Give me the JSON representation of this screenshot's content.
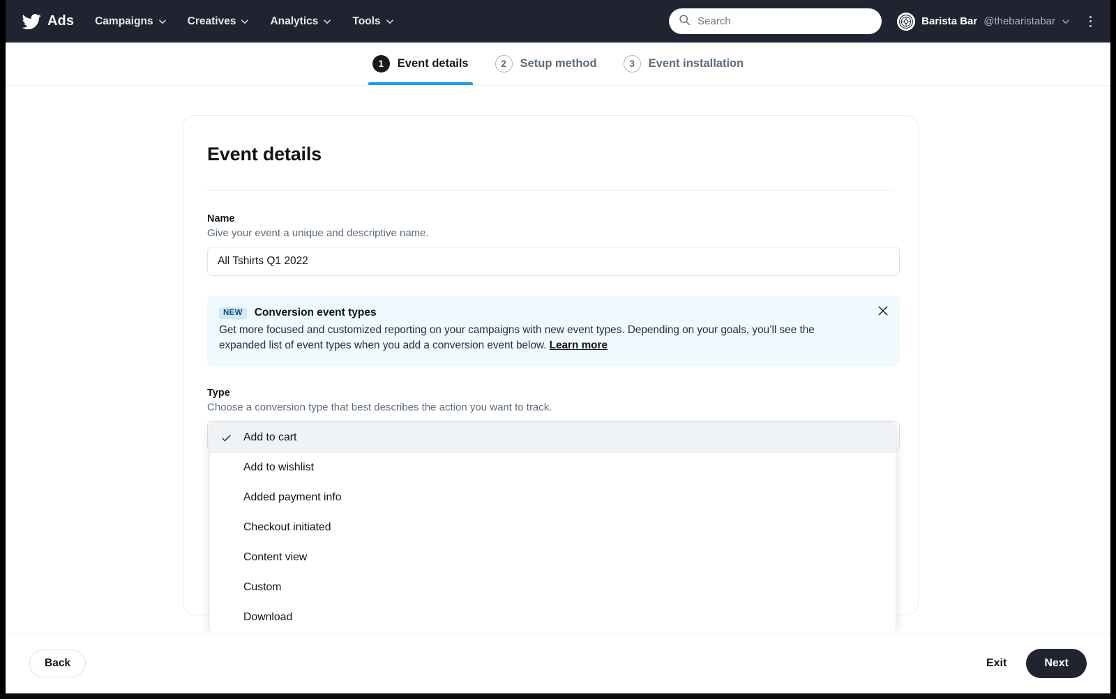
{
  "header": {
    "brand": "Ads",
    "brand_icon": "twitter-bird-icon",
    "nav_items": [
      {
        "label": "Campaigns",
        "icon": "chevron-down-icon"
      },
      {
        "label": "Creatives",
        "icon": "chevron-down-icon"
      },
      {
        "label": "Analytics",
        "icon": "chevron-down-icon"
      },
      {
        "label": "Tools",
        "icon": "chevron-down-icon"
      }
    ],
    "search": {
      "placeholder": "Search",
      "value": "",
      "icon": "search-icon"
    },
    "account": {
      "avatar_icon": "account-avatar-icon",
      "name": "Barista Bar",
      "handle": "@thebaristabar",
      "caret_icon": "chevron-down-icon"
    },
    "overflow_icon": "kebab-menu-icon"
  },
  "steps": [
    {
      "num": "1",
      "label": "Event details",
      "state": "active"
    },
    {
      "num": "2",
      "label": "Setup method",
      "state": "idle"
    },
    {
      "num": "3",
      "label": "Event installation",
      "state": "idle"
    }
  ],
  "card": {
    "title": "Event details",
    "name_field": {
      "label": "Name",
      "help": "Give your event a unique and descriptive name.",
      "value": "All Tshirts Q1 2022",
      "placeholder": ""
    },
    "banner": {
      "badge": "NEW",
      "title": "Conversion event types",
      "body": "Get more focused and customized reporting on your campaigns with new event types. Depending on your goals, you’ll see the expanded list of event types when you add a conversion event below.",
      "link": "Learn more",
      "close_icon": "close-icon",
      "bg_color": "#f0f9fd",
      "badge_bg": "#cfe9fa"
    },
    "type_field": {
      "label": "Type",
      "help": "Choose a conversion type that best describes the action you want to track.",
      "selected": "Add to cart",
      "caret_icon": "chevron-down-icon",
      "options": [
        {
          "label": "Add to cart",
          "selected": true,
          "icon": "check-icon"
        },
        {
          "label": "Add to wishlist",
          "selected": false
        },
        {
          "label": "Added payment info",
          "selected": false
        },
        {
          "label": "Checkout initiated",
          "selected": false
        },
        {
          "label": "Content view",
          "selected": false
        },
        {
          "label": "Custom",
          "selected": false
        },
        {
          "label": "Download",
          "selected": false
        }
      ]
    }
  },
  "footer": {
    "back_label": "Back",
    "exit_label": "Exit",
    "next_label": "Next"
  },
  "colors": {
    "nav_bg": "#1f2430",
    "accent_blue": "#1d9bf0",
    "text_primary": "#0f1419",
    "text_muted": "#5b6b7b"
  }
}
